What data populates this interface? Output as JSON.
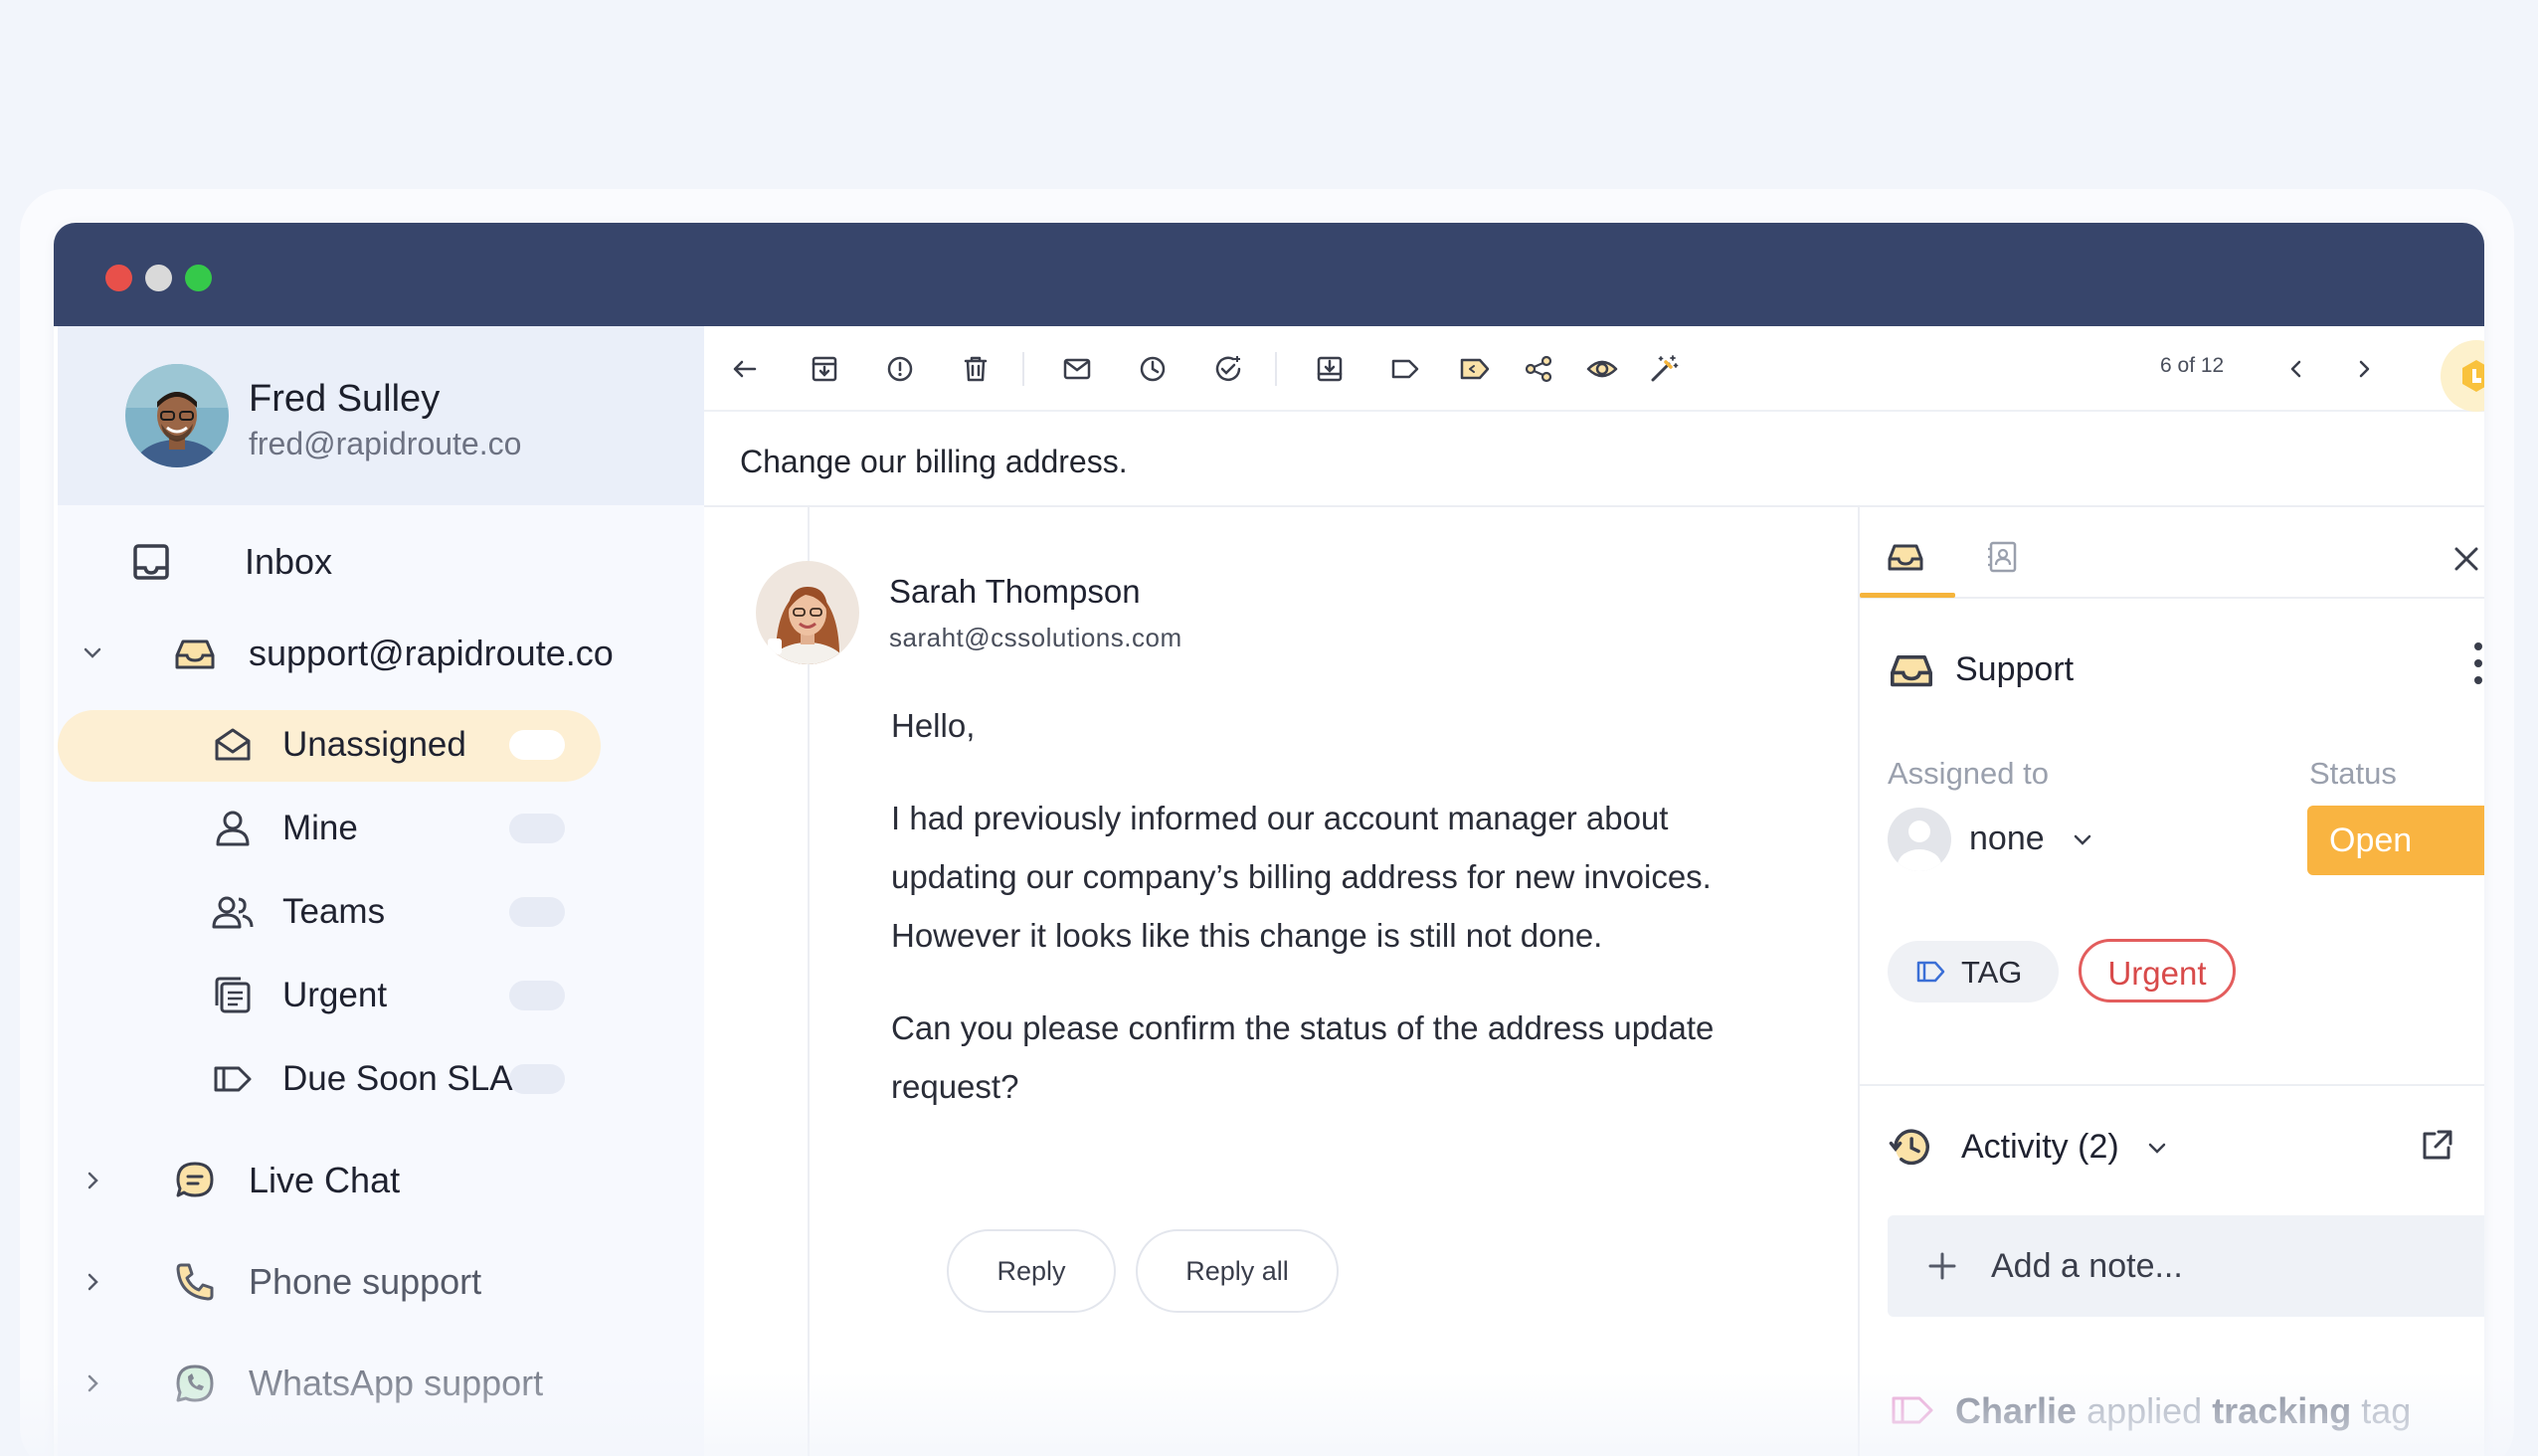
{
  "window_controls": {
    "close_color": "#e8504a",
    "minimize_color": "#d9d9d9",
    "maximize_color": "#35c94a"
  },
  "profile": {
    "name": "Fred Sulley",
    "email": "fred@rapidroute.co"
  },
  "nav": {
    "inbox": "Inbox",
    "support_group": "support@rapidroute.co",
    "sub_items": [
      {
        "label": "Unassigned",
        "icon": "envelope-open-icon",
        "selected": true
      },
      {
        "label": "Mine",
        "icon": "user-icon"
      },
      {
        "label": "Teams",
        "icon": "users-icon"
      },
      {
        "label": "Urgent",
        "icon": "document-stack-icon"
      },
      {
        "label": "Due Soon SLAs",
        "icon": "tag-icon"
      }
    ],
    "live_chat": "Live Chat",
    "phone_support": "Phone support",
    "whatsapp_support": "WhatsApp support"
  },
  "toolbar": {
    "pager": "6 of 12"
  },
  "subject": "Change our billing address.",
  "message": {
    "sender_name": "Sarah Thompson",
    "sender_email": "saraht@cssolutions.com",
    "greeting": "Hello,",
    "paragraph1": "I had previously informed our account manager about updating our company’s billing address for new invoices. However it looks like this change is still not done.",
    "paragraph2": "Can you please confirm the status of the address update request?",
    "reply_label": "Reply",
    "reply_all_label": "Reply all"
  },
  "panel": {
    "inbox_name": "Support",
    "assigned_label": "Assigned to",
    "assigned_value": "none",
    "status_label": "Status",
    "status_value": "Open",
    "status_color": "#f9b441",
    "tag_label": "TAG",
    "urgent_label": "Urgent",
    "activity_label": "Activity (2)",
    "note_placeholder": "Add a note...",
    "activity_who": "Charlie",
    "activity_what": "applied",
    "activity_tag": "tracking",
    "activity_tail": "tag"
  }
}
